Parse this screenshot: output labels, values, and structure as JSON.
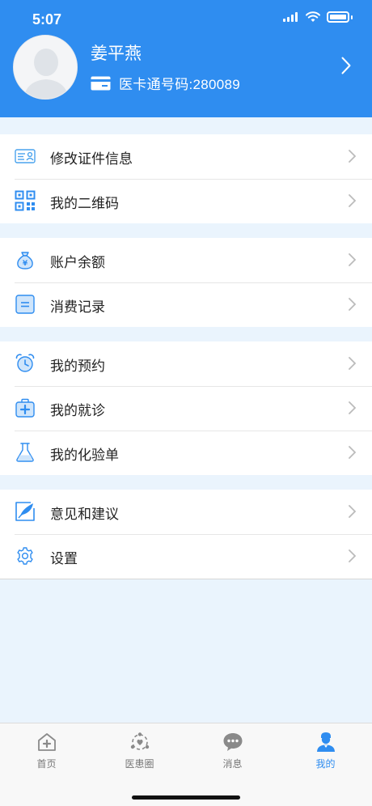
{
  "status_bar": {
    "time": "5:07"
  },
  "profile": {
    "name": "姜平燕",
    "card_label": "医卡通号码:280089"
  },
  "menu_groups": [
    {
      "items": [
        {
          "label": "修改证件信息",
          "icon": "id-card-icon"
        },
        {
          "label": "我的二维码",
          "icon": "qr-code-icon"
        }
      ]
    },
    {
      "items": [
        {
          "label": "账户余额",
          "icon": "money-bag-icon"
        },
        {
          "label": "消费记录",
          "icon": "receipt-icon"
        }
      ]
    },
    {
      "items": [
        {
          "label": "我的预约",
          "icon": "alarm-clock-icon"
        },
        {
          "label": "我的就诊",
          "icon": "medical-kit-icon"
        },
        {
          "label": "我的化验单",
          "icon": "flask-icon"
        }
      ]
    },
    {
      "items": [
        {
          "label": "意见和建议",
          "icon": "edit-feather-icon"
        },
        {
          "label": "设置",
          "icon": "gear-icon"
        }
      ]
    }
  ],
  "tabbar": {
    "tabs": [
      {
        "label": "首页",
        "icon": "home-plus-icon",
        "active": false
      },
      {
        "label": "医患圈",
        "icon": "doctor-circle-icon",
        "active": false
      },
      {
        "label": "消息",
        "icon": "chat-bubble-icon",
        "active": false
      },
      {
        "label": "我的",
        "icon": "user-icon",
        "active": true
      }
    ]
  },
  "colors": {
    "brand": "#2f8df0",
    "page_bg": "#eaf4fd",
    "inactive_tab": "#777777"
  }
}
